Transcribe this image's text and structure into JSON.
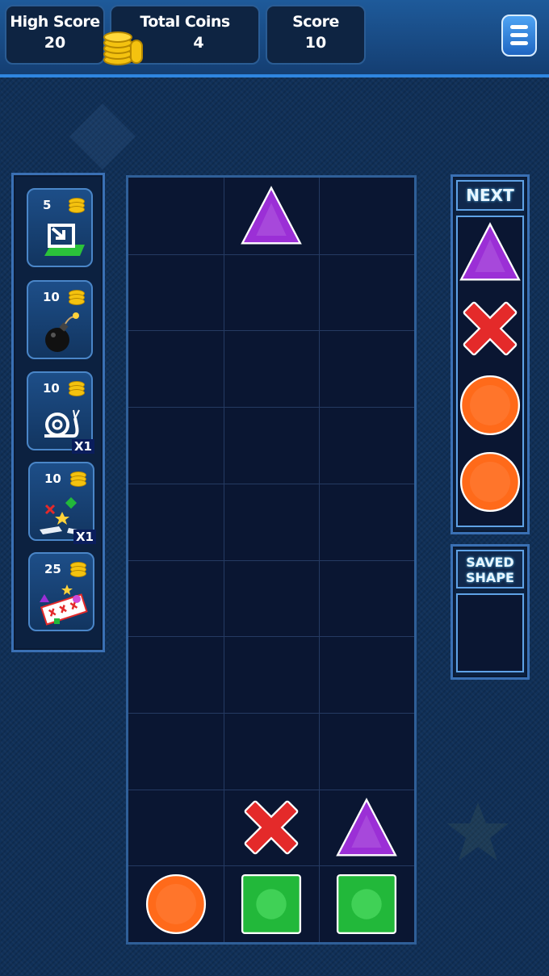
{
  "header": {
    "high_score_label": "High Score",
    "high_score_value": "20",
    "total_coins_label": "Total Coins",
    "total_coins_value": "4",
    "score_label": "Score",
    "score_value": "10"
  },
  "powerups": [
    {
      "cost": "5",
      "icon": "drop-shape-icon",
      "count": ""
    },
    {
      "cost": "10",
      "icon": "bomb-icon",
      "count": ""
    },
    {
      "cost": "10",
      "icon": "snail-icon",
      "count": "X1"
    },
    {
      "cost": "10",
      "icon": "shatter-icon",
      "count": "X1"
    },
    {
      "cost": "25",
      "icon": "shuffle-board-icon",
      "count": ""
    }
  ],
  "next_panel": {
    "title": "NEXT",
    "queue": [
      "triangle",
      "x",
      "circle",
      "circle"
    ]
  },
  "saved_panel": {
    "title_line1": "SAVED",
    "title_line2": "SHAPE",
    "shape": null
  },
  "board": {
    "columns": 3,
    "rows": 10,
    "falling_piece": {
      "shape": "triangle",
      "column": 2,
      "row": 1
    },
    "cells": [
      {
        "shape": "x",
        "column": 2,
        "row": 9
      },
      {
        "shape": "triangle",
        "column": 3,
        "row": 9
      },
      {
        "shape": "circle",
        "column": 1,
        "row": 10
      },
      {
        "shape": "square",
        "column": 2,
        "row": 10
      },
      {
        "shape": "square",
        "column": 3,
        "row": 10
      }
    ]
  },
  "colors": {
    "triangle": "#9b2fd6",
    "x": "#e42a2a",
    "circle": "#ff6a1a",
    "square": "#22b83a",
    "coin": "#f4c20f"
  }
}
